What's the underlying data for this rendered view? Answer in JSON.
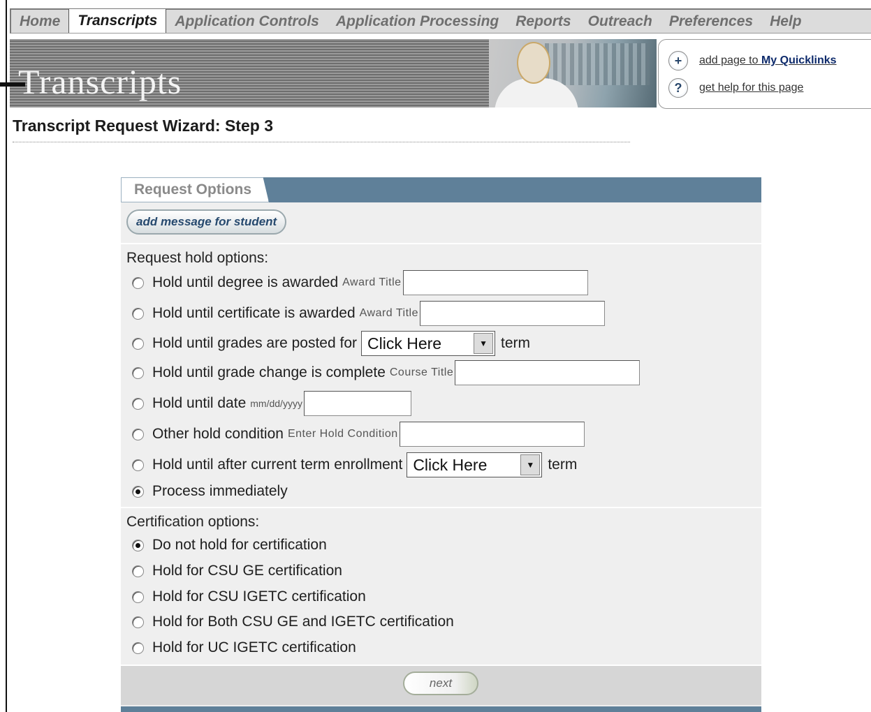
{
  "nav": {
    "items": [
      {
        "label": "Home",
        "active": false
      },
      {
        "label": "Transcripts",
        "active": true
      },
      {
        "label": "Application Controls",
        "active": false
      },
      {
        "label": "Application Processing",
        "active": false
      },
      {
        "label": "Reports",
        "active": false
      },
      {
        "label": "Outreach",
        "active": false
      },
      {
        "label": "Preferences",
        "active": false
      },
      {
        "label": "Help",
        "active": false
      }
    ]
  },
  "banner": {
    "title": "Transcripts"
  },
  "quicklinks": {
    "add_prefix": "add page to ",
    "add_strong": "My Quicklinks",
    "add_icon": "+",
    "help_text": "get help for this page",
    "help_icon": "?"
  },
  "page": {
    "title": "Transcript Request Wizard: Step 3"
  },
  "panel": {
    "tab_label": "Request Options",
    "add_message_label": "add message for student",
    "hold_section_label": "Request hold options:",
    "hold_options": [
      {
        "label": "Hold until degree is awarded",
        "field_label": "Award Title",
        "checked": false
      },
      {
        "label": "Hold until certificate is awarded",
        "field_label": "Award Title",
        "checked": false
      },
      {
        "label": "Hold until grades are posted for",
        "select_value": "Click Here",
        "suffix": "term",
        "checked": false
      },
      {
        "label": "Hold until grade change is complete",
        "field_label": "Course Title",
        "checked": false
      },
      {
        "label": "Hold until date",
        "field_label": "mm/dd/yyyy",
        "checked": false
      },
      {
        "label": "Other hold condition",
        "field_label": "Enter Hold Condition",
        "checked": false
      },
      {
        "label": "Hold until after current term enrollment",
        "select_value": "Click Here",
        "suffix": "term",
        "checked": false
      },
      {
        "label": "Process immediately",
        "checked": true
      }
    ],
    "cert_section_label": "Certification options:",
    "cert_options": [
      {
        "label": "Do not hold for certification",
        "checked": true
      },
      {
        "label": "Hold for CSU GE certification",
        "checked": false
      },
      {
        "label": "Hold for CSU IGETC certification",
        "checked": false
      },
      {
        "label": "Hold for Both CSU GE and IGETC certification",
        "checked": false
      },
      {
        "label": "Hold for UC IGETC certification",
        "checked": false
      }
    ],
    "next_label": "next"
  },
  "colors": {
    "panel_header": "#5f8099",
    "panel_bg": "#efefef",
    "link_dark": "#0d2a6b"
  }
}
